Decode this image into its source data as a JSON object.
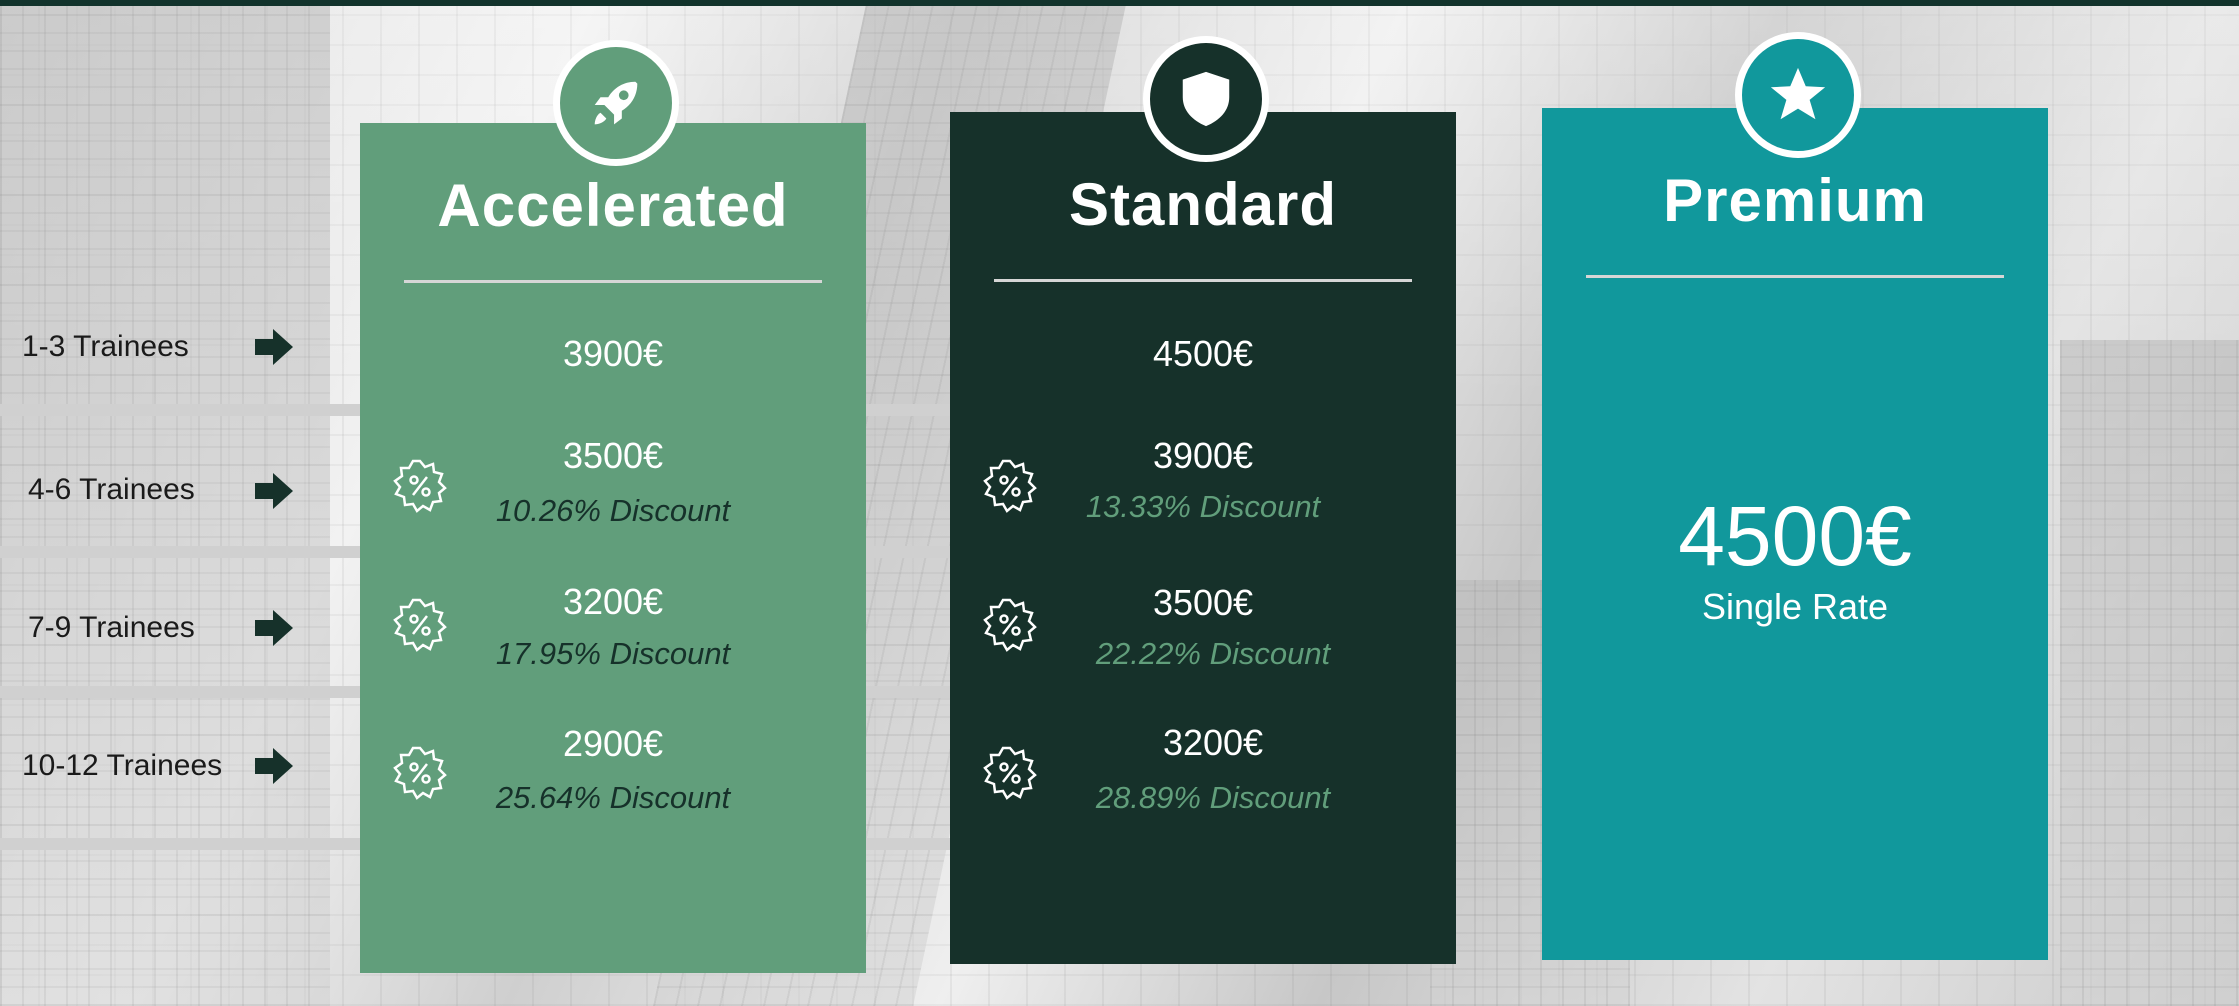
{
  "rows": [
    {
      "label": "1-3 Trainees"
    },
    {
      "label": "4-6 Trainees"
    },
    {
      "label": "7-9 Trainees"
    },
    {
      "label": "10-12 Trainees"
    }
  ],
  "plans": {
    "accelerated": {
      "title": "Accelerated",
      "icon": "rocket-icon",
      "color": "#619e7b",
      "prices": [
        "3900€",
        "3500€",
        "3200€",
        "2900€"
      ],
      "discounts": [
        "",
        "10.26% Discount",
        "17.95% Discount",
        "25.64% Discount"
      ]
    },
    "standard": {
      "title": "Standard",
      "icon": "shield-icon",
      "color": "#16312a",
      "prices": [
        "4500€",
        "3900€",
        "3500€",
        "3200€"
      ],
      "discounts": [
        "",
        "13.33% Discount",
        "22.22% Discount",
        "28.89% Discount"
      ]
    },
    "premium": {
      "title": "Premium",
      "icon": "star-icon",
      "color": "#11989c",
      "price": "4500€",
      "subtitle": "Single Rate"
    }
  },
  "icons": {
    "row_marker": "arrow-right-icon",
    "discount_marker": "percent-badge-icon"
  }
}
